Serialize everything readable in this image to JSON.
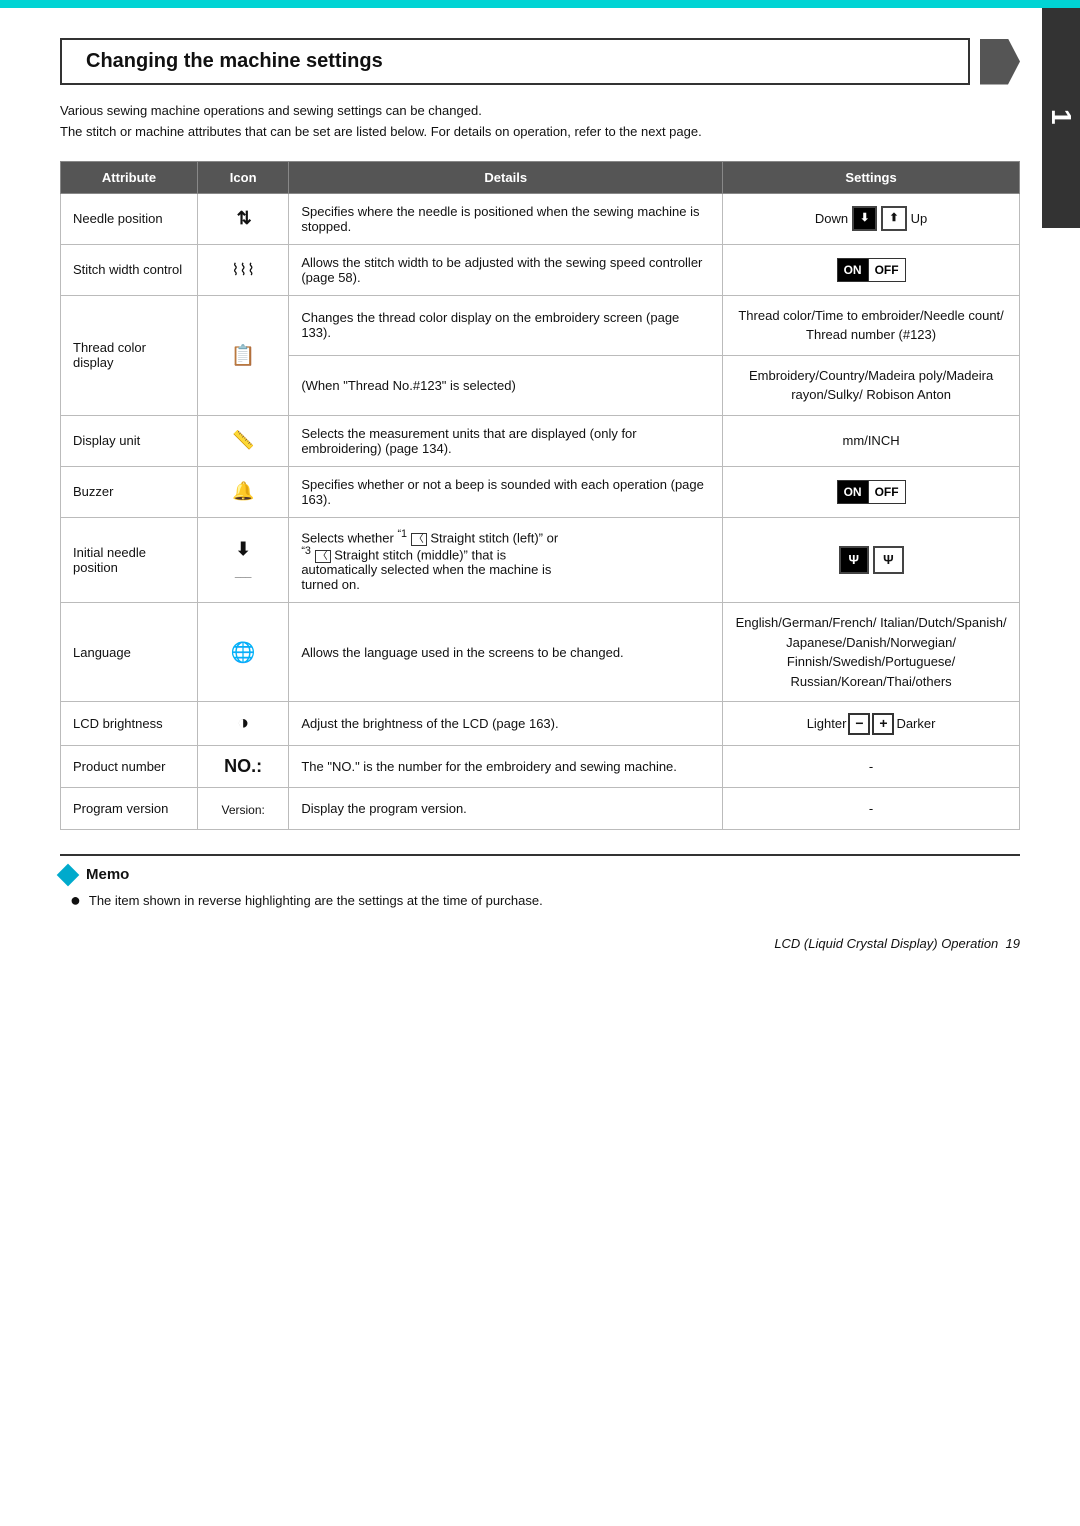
{
  "topbar": {
    "color": "#00d4d4"
  },
  "chapter": "1",
  "section": {
    "title": "Changing the machine settings",
    "intro_lines": [
      "Various sewing machine operations and sewing settings can be changed.",
      "The stitch or machine attributes that can be set are listed below. For details on operation, refer to the next page."
    ]
  },
  "table": {
    "headers": [
      "Attribute",
      "Icon",
      "Details",
      "Settings"
    ],
    "rows": [
      {
        "attribute": "Needle position",
        "icon": "needle-position-icon",
        "icon_char": "⬆⬇",
        "details": "Specifies where the needle is positioned when the sewing machine is stopped.",
        "settings": "needle-pos",
        "settings_text": "Down / Up"
      },
      {
        "attribute": "Stitch width control",
        "icon": "stitch-width-icon",
        "icon_char": "⚙",
        "details": "Allows the stitch width to be adjusted with the sewing speed controller (page 58).",
        "settings": "on-off",
        "settings_text": "ON OFF"
      },
      {
        "attribute": "Thread color display",
        "icon": "thread-color-icon",
        "icon_char": "🖥",
        "details_1": "Changes the thread color display on the embroidery screen (page 133).",
        "details_2": "(When \"Thread No.#123\" is selected)",
        "settings_1": "Thread color/Time to embroider/Needle count/ Thread number (#123)",
        "settings_2": "Embroidery/Country/Madeira poly/Madeira rayon/Sulky/ Robison Anton"
      },
      {
        "attribute": "Display unit",
        "icon": "display-unit-icon",
        "icon_char": "📐",
        "details": "Selects the measurement units that are displayed (only for embroidering) (page 134).",
        "settings": "text",
        "settings_text": "mm/INCH"
      },
      {
        "attribute": "Buzzer",
        "icon": "buzzer-icon",
        "icon_char": "🔔",
        "details": "Specifies whether or not a beep is sounded with each operation (page 163).",
        "settings": "on-off",
        "settings_text": "ON OFF"
      },
      {
        "attribute": "Initial needle position",
        "icon": "initial-needle-icon",
        "icon_char": "⬇",
        "details": "Selects whether \"¹ □ Straight stitch (left)\" or \"³ □ Straight stitch (middle)\" that is automatically selected when the machine is turned on.",
        "settings": "needle-init",
        "settings_text": "1 / 3"
      },
      {
        "attribute": "Language",
        "icon": "language-icon",
        "icon_char": "🌐",
        "details": "Allows the language used in the screens to be changed.",
        "settings": "text",
        "settings_text": "English/German/French/ Italian/Dutch/Spanish/ Japanese/Danish/Norwegian/ Finnish/Swedish/Portuguese/ Russian/Korean/Thai/others"
      },
      {
        "attribute": "LCD brightness",
        "icon": "lcd-brightness-icon",
        "icon_char": "◑",
        "details": "Adjust the brightness of the LCD (page 163).",
        "settings": "lighter-darker",
        "settings_text": "Lighter − + Darker"
      },
      {
        "attribute": "Product number",
        "icon": "product-number-icon",
        "icon_char": "NO.:",
        "details": "The \"NO.\" is the number for the embroidery and sewing machine.",
        "settings": "text",
        "settings_text": "-"
      },
      {
        "attribute": "Program version",
        "icon": "program-version-icon",
        "icon_char": "Version:",
        "details": "Display the program version.",
        "settings": "text",
        "settings_text": "-"
      }
    ]
  },
  "memo": {
    "title": "Memo",
    "items": [
      "The item shown in reverse highlighting are the settings at the time of purchase."
    ]
  },
  "footer": {
    "text": "LCD (Liquid Crystal Display) Operation",
    "page": "19"
  }
}
